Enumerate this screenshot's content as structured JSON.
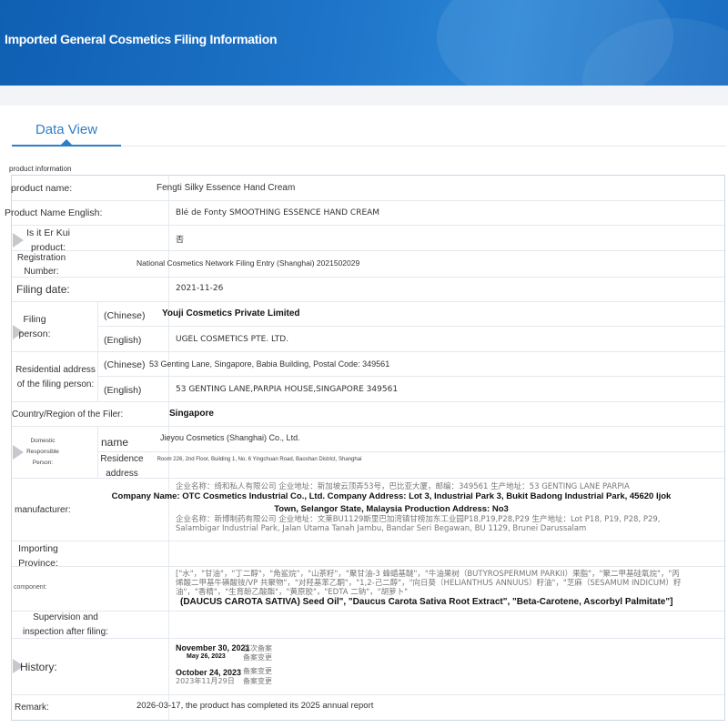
{
  "header": {
    "title": "Imported General Cosmetics Filing Information"
  },
  "tabs": [
    {
      "label": "Data View",
      "active": true
    }
  ],
  "section": {
    "label": "product information"
  },
  "rows": {
    "product_name": {
      "label": "product name:",
      "value": "Fengti Silky Essence Hand Cream"
    },
    "product_name_en": {
      "label": "Product Name English:",
      "value": "Blé de Fonty SMOOTHING ESSENCE HAND CREAM"
    },
    "is_er_kui": {
      "label": "Is it Er Kui product:",
      "value": "否"
    },
    "registration": {
      "label": "Registration Number:",
      "value": "National Cosmetics Network Filing Entry (Shanghai) 2021502029"
    },
    "filing_date": {
      "label": "Filing date:",
      "value": "2021-11-26"
    },
    "filing_person": {
      "label": "Filing person:",
      "chinese_label": "(Chinese)",
      "chinese_value": "Youji Cosmetics Private Limited",
      "english_label": "(English)",
      "english_value": "UGEL COSMETICS PTE. LTD."
    },
    "residential_address": {
      "label": "Residential address of the filing person:",
      "chinese_label": "(Chinese)",
      "chinese_value": "53 Genting Lane, Singapore, Babia Building, Postal Code: 349561",
      "english_label": "(English)",
      "english_value": "53 GENTING LANE,PARPIA HOUSE,SINGAPORE 349561"
    },
    "country": {
      "label": "Country/Region of the Filer:",
      "value": "Singapore"
    },
    "domestic": {
      "label": "Domestic Responsible Person:",
      "name_label": "name",
      "name_value": "Jieyou Cosmetics (Shanghai) Co., Ltd.",
      "address_label": "Residence address",
      "address_value": "Room 226, 2nd Floor, Building 1, No. 6 Yingchuan Road, Baoshan District, Shanghai"
    },
    "manufacturer": {
      "label": "manufacturer:",
      "original_line1": "企业名称：绮和私人有限公司 企业地址：新加坡云顶弄53号，巴比亚大厦，邮编：349561 生产地址：53 GENTING LANE PARPIA",
      "overlay": "Company Name: OTC Cosmetics Industrial Co., Ltd. Company Address: Lot 3, Industrial Park 3, Bukit Badong Industrial Park, 45620 Ijok Town, Selangor State, Malaysia Production Address: No3",
      "original_line2": "企业名称：新博制药有限公司 企业地址：文莱BU1129斯里巴加湾镇甘榜加东工业园P18,P19,P28,P29 生产地址：Lot P18, P19, P28, P29, Salambigar Industrial Park, Jalan Utama Tanah Jambu, Bandar Seri Begawan, BU 1129, Brunei Darussalam"
    },
    "importing": {
      "label": "Importing Province:",
      "value": ""
    },
    "component": {
      "label": "component:",
      "original": "[\"水\"，\"甘油\"，\"丁二醇\"，\"角鲨烷\"，\"山茶籽\"，\"聚甘油-3 蜂蜡基醚\"，\"牛油果树（BUTYROSPERMUM PARKII）果脂\"，\"聚二甲基硅氧烷\"，\"丙烯酸二甲基牛磺酸铵/VP 共聚物\"，\"对羟基苯乙酮\"，\"1,2-己二醇\"，\"向日葵（HELIANTHUS ANNUUS）籽油\"，\"芝麻（SESAMUM INDICUM）籽油\"，\"香精\"，\"生育酚乙酸酯\"，\"黄原胶\"，\"EDTA 二钠\"，\"胡萝卜\"",
      "overlay": "(DAUCUS CAROTA SATIVA) Seed Oil\", \"Daucus Carota Sativa Root Extract\", \"Beta-Carotene, Ascorbyl Palmitate\"]"
    },
    "supervision": {
      "label": "Supervision and inspection after filing:",
      "value": ""
    },
    "history": {
      "label": "History:",
      "entries": [
        "November 30, 2021",
        "May 26, 2023",
        "October 24, 2023",
        "2023年11月29日"
      ],
      "status_original": [
        "首次备案",
        "备案变更",
        "备案变更",
        "备案变更"
      ]
    },
    "remark": {
      "label": "Remark:",
      "value": "2026-03-17, the product has completed its 2025 annual report"
    }
  }
}
